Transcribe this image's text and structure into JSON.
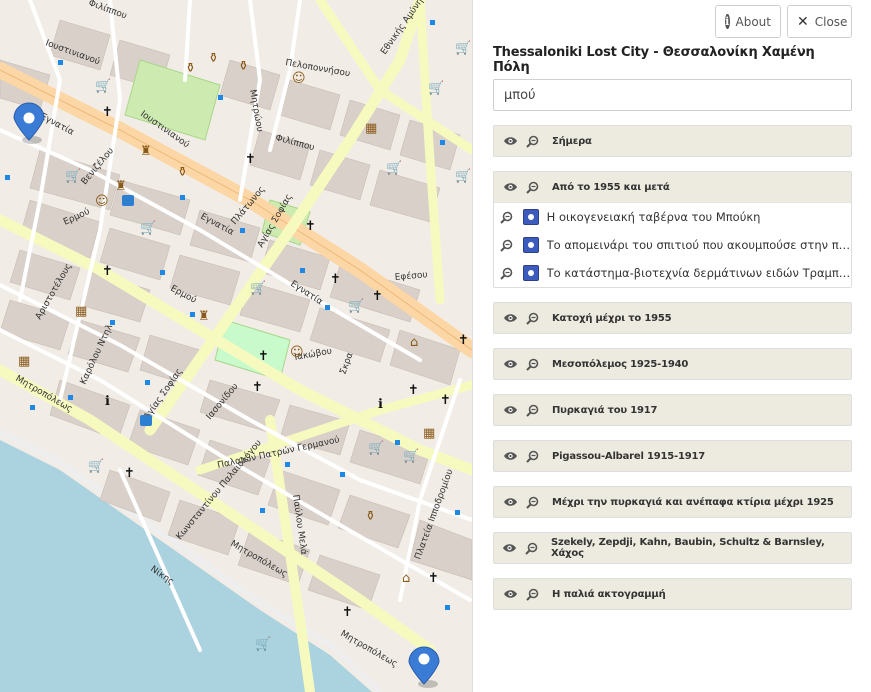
{
  "panel": {
    "about_label": "About",
    "close_label": "Close",
    "title": "Thessaloniki Lost City - Θεσσαλονίκη Χαμένη Πόλη",
    "search_value": "μπού",
    "layers": [
      {
        "title": "Σήμερα",
        "expanded": false,
        "items": []
      },
      {
        "title": "Από το 1955 και μετά",
        "expanded": true,
        "items": [
          {
            "label": "Η οικογενειακή ταβέρνα του Μπούκη"
          },
          {
            "label": "Το απομεινάρι του σπιτιού που ακουμπούσε στην πολυκατοικία"
          },
          {
            "label": "Το κατάστημα-βιοτεχνία δερμάτινων ειδών Τραμπούκη"
          }
        ]
      },
      {
        "title": "Κατοχή μέχρι το 1955",
        "expanded": false,
        "items": []
      },
      {
        "title": "Μεσοπόλεμος 1925-1940",
        "expanded": false,
        "items": []
      },
      {
        "title": "Πυρκαγιά του 1917",
        "expanded": false,
        "items": []
      },
      {
        "title": "Pigassou-Albarel 1915-1917",
        "expanded": false,
        "items": []
      },
      {
        "title": "Μέχρι την πυρκαγιά και ανέπαφα κτίρια μέχρι 1925",
        "expanded": false,
        "items": []
      },
      {
        "title": "Szekely, Zepdji, Kahn, Baubin, Schultz & Barnsley, Χάχος",
        "expanded": false,
        "items": []
      },
      {
        "title": "Η παλιά ακτογραμμή",
        "expanded": false,
        "items": []
      }
    ]
  },
  "map": {
    "colors": {
      "sea": "#aad3df",
      "primary_road": "#fcd6a4",
      "secondary_road": "#f7fabf",
      "building": "#d9d0c9",
      "park": "#c8facc",
      "pin": "#3a7bd5"
    },
    "streets": [
      {
        "label": "Εγνατία"
      },
      {
        "label": "Ερμού"
      },
      {
        "label": "Μητροπόλεως"
      },
      {
        "label": "Νίκης"
      },
      {
        "label": "Τσιμισκή"
      },
      {
        "label": "Παλαιών Πατρών Γερμανού"
      },
      {
        "label": "Παύλου Μελά"
      },
      {
        "label": "Αγίας Σοφίας"
      },
      {
        "label": "Ιουστινιανού"
      },
      {
        "label": "Κωνσταντίνου Παλαιολόγου"
      },
      {
        "label": "Πλατεία Ιπποδρομίου"
      },
      {
        "label": "Φιλίππου"
      },
      {
        "label": "Ναυαρίνου"
      },
      {
        "label": "Καρόλου Ντηλ"
      },
      {
        "label": "Αριστοτέλους"
      },
      {
        "label": "Βενιζέλου"
      },
      {
        "label": "Δημ. Γούναρη"
      },
      {
        "label": "Κασσάνδρου"
      },
      {
        "label": "Εθνικής Αμύνης"
      },
      {
        "label": "Ιασονίδου"
      },
      {
        "label": "Βασιλίσσης Όλγας"
      },
      {
        "label": "Πλάτωνος"
      },
      {
        "label": "Πελοποννήσου"
      },
      {
        "label": "Μητρώου"
      },
      {
        "label": "Εφέσου"
      },
      {
        "label": "Κρήτης"
      },
      {
        "label": "Σκρα"
      },
      {
        "label": "Ιακώβου"
      }
    ]
  }
}
